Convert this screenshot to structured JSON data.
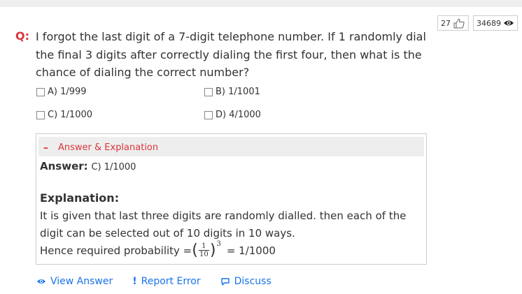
{
  "stats": {
    "likes": "27",
    "views": "34689"
  },
  "question": {
    "label": "Q:",
    "text": "I forgot the last digit of a 7-digit telephone number. If 1 randomly dial the final 3 digits after correctly dialing the first four, then what is the chance of dialing the correct number?",
    "options": [
      {
        "label": "A) 1/999"
      },
      {
        "label": "B) 1/1001"
      },
      {
        "label": "C) 1/1000"
      },
      {
        "label": "D) 4/1000"
      }
    ]
  },
  "answer_section": {
    "toggle_symbol": "–",
    "title": "Answer & Explanation",
    "answer_label": "Answer:",
    "answer_value": "C) 1/1000",
    "explanation_title": "Explanation:",
    "explanation_text": "It is given that last three digits are randomly dialled. then each of the digit can be selected out of 10 digits in 10 ways.",
    "probability_prefix": "Hence required probability =",
    "fraction_numerator": "1",
    "fraction_denominator": "10",
    "exponent": "3",
    "probability_result": "= 1/1000"
  },
  "actions": {
    "view_answer": "View Answer",
    "report_error": "Report Error",
    "discuss": "Discuss"
  },
  "colors": {
    "accent_red": "#d9363e",
    "link_blue": "#1a73e8"
  }
}
